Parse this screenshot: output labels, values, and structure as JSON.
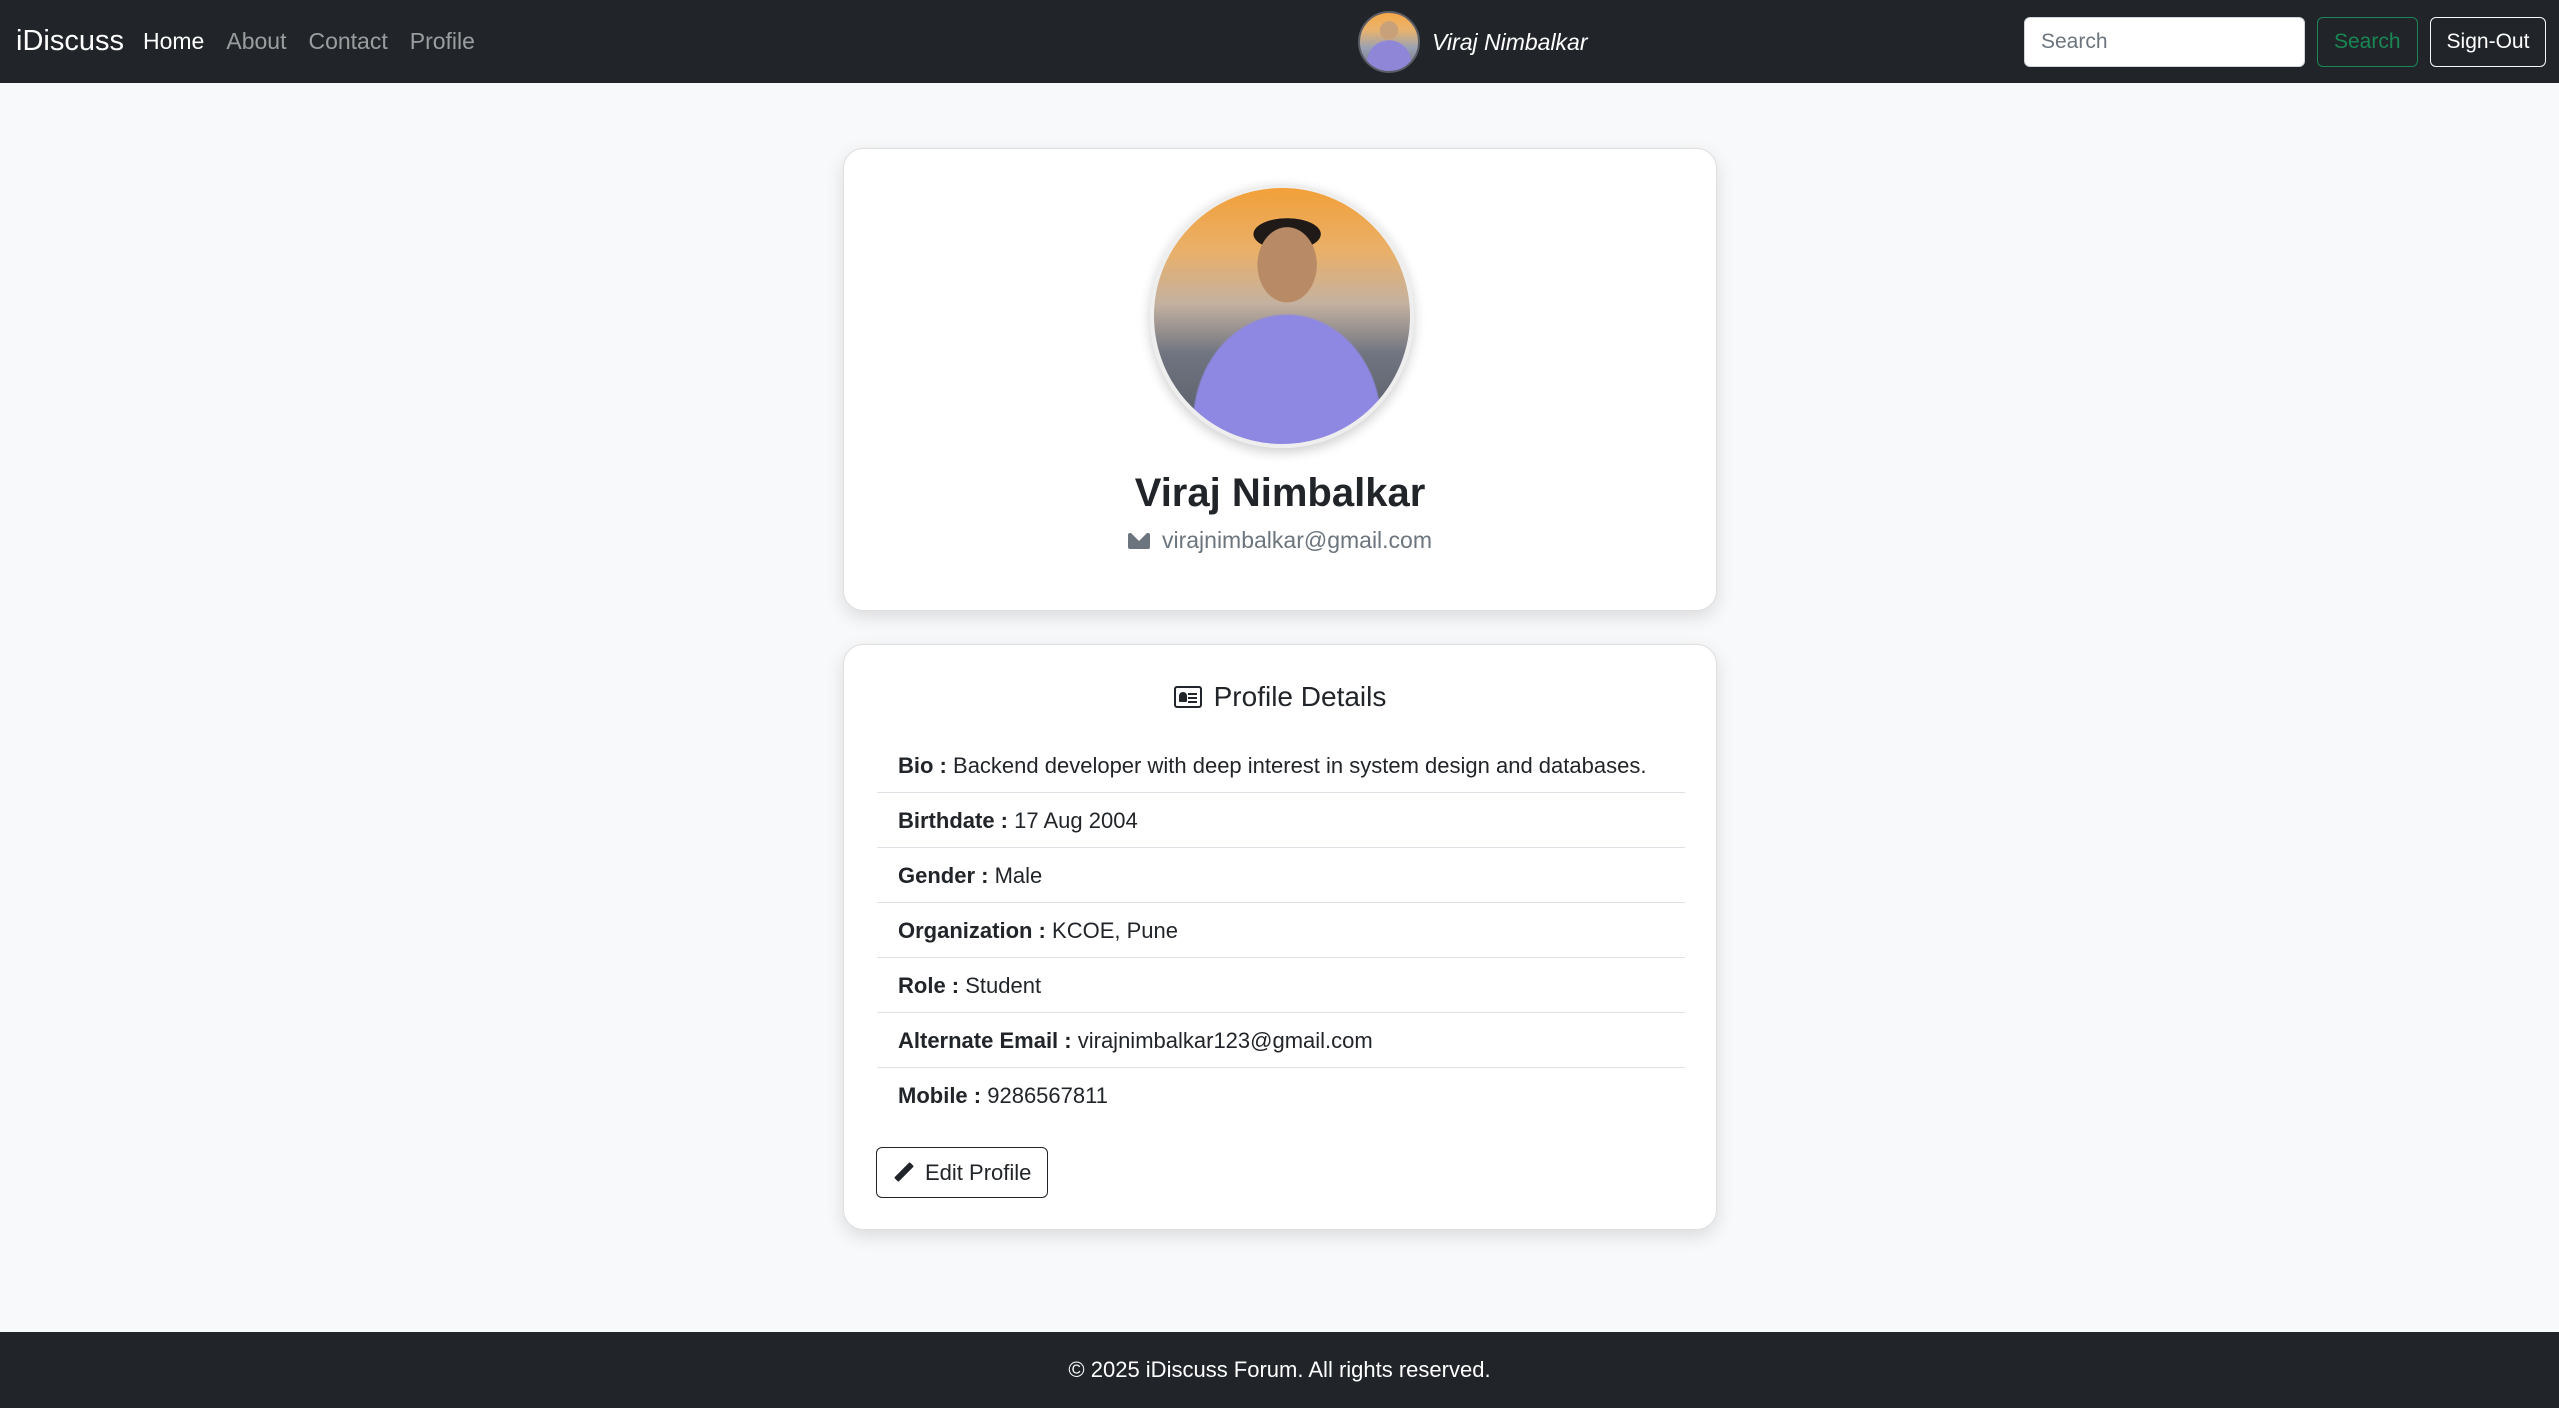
{
  "navbar": {
    "brand": "iDiscuss",
    "links": [
      "Home",
      "About",
      "Contact",
      "Profile"
    ],
    "username": "Viraj Nimbalkar",
    "search_placeholder": "Search",
    "search_button": "Search",
    "signout_button": "Sign-Out"
  },
  "profile": {
    "name": "Viraj Nimbalkar",
    "email": "virajnimbalkar@gmail.com"
  },
  "details": {
    "heading": "Profile Details",
    "items": [
      {
        "label": "Bio :",
        "value": "Backend developer with deep interest in system design and databases."
      },
      {
        "label": "Birthdate :",
        "value": "17 Aug 2004"
      },
      {
        "label": "Gender :",
        "value": "Male"
      },
      {
        "label": "Organization :",
        "value": "KCOE, Pune"
      },
      {
        "label": "Role :",
        "value": "Student"
      },
      {
        "label": "Alternate Email :",
        "value": "virajnimbalkar123@gmail.com"
      },
      {
        "label": "Mobile :",
        "value": "9286567811"
      }
    ],
    "edit_button": "Edit Profile"
  },
  "footer": {
    "text": "© 2025 iDiscuss Forum. All rights reserved."
  }
}
